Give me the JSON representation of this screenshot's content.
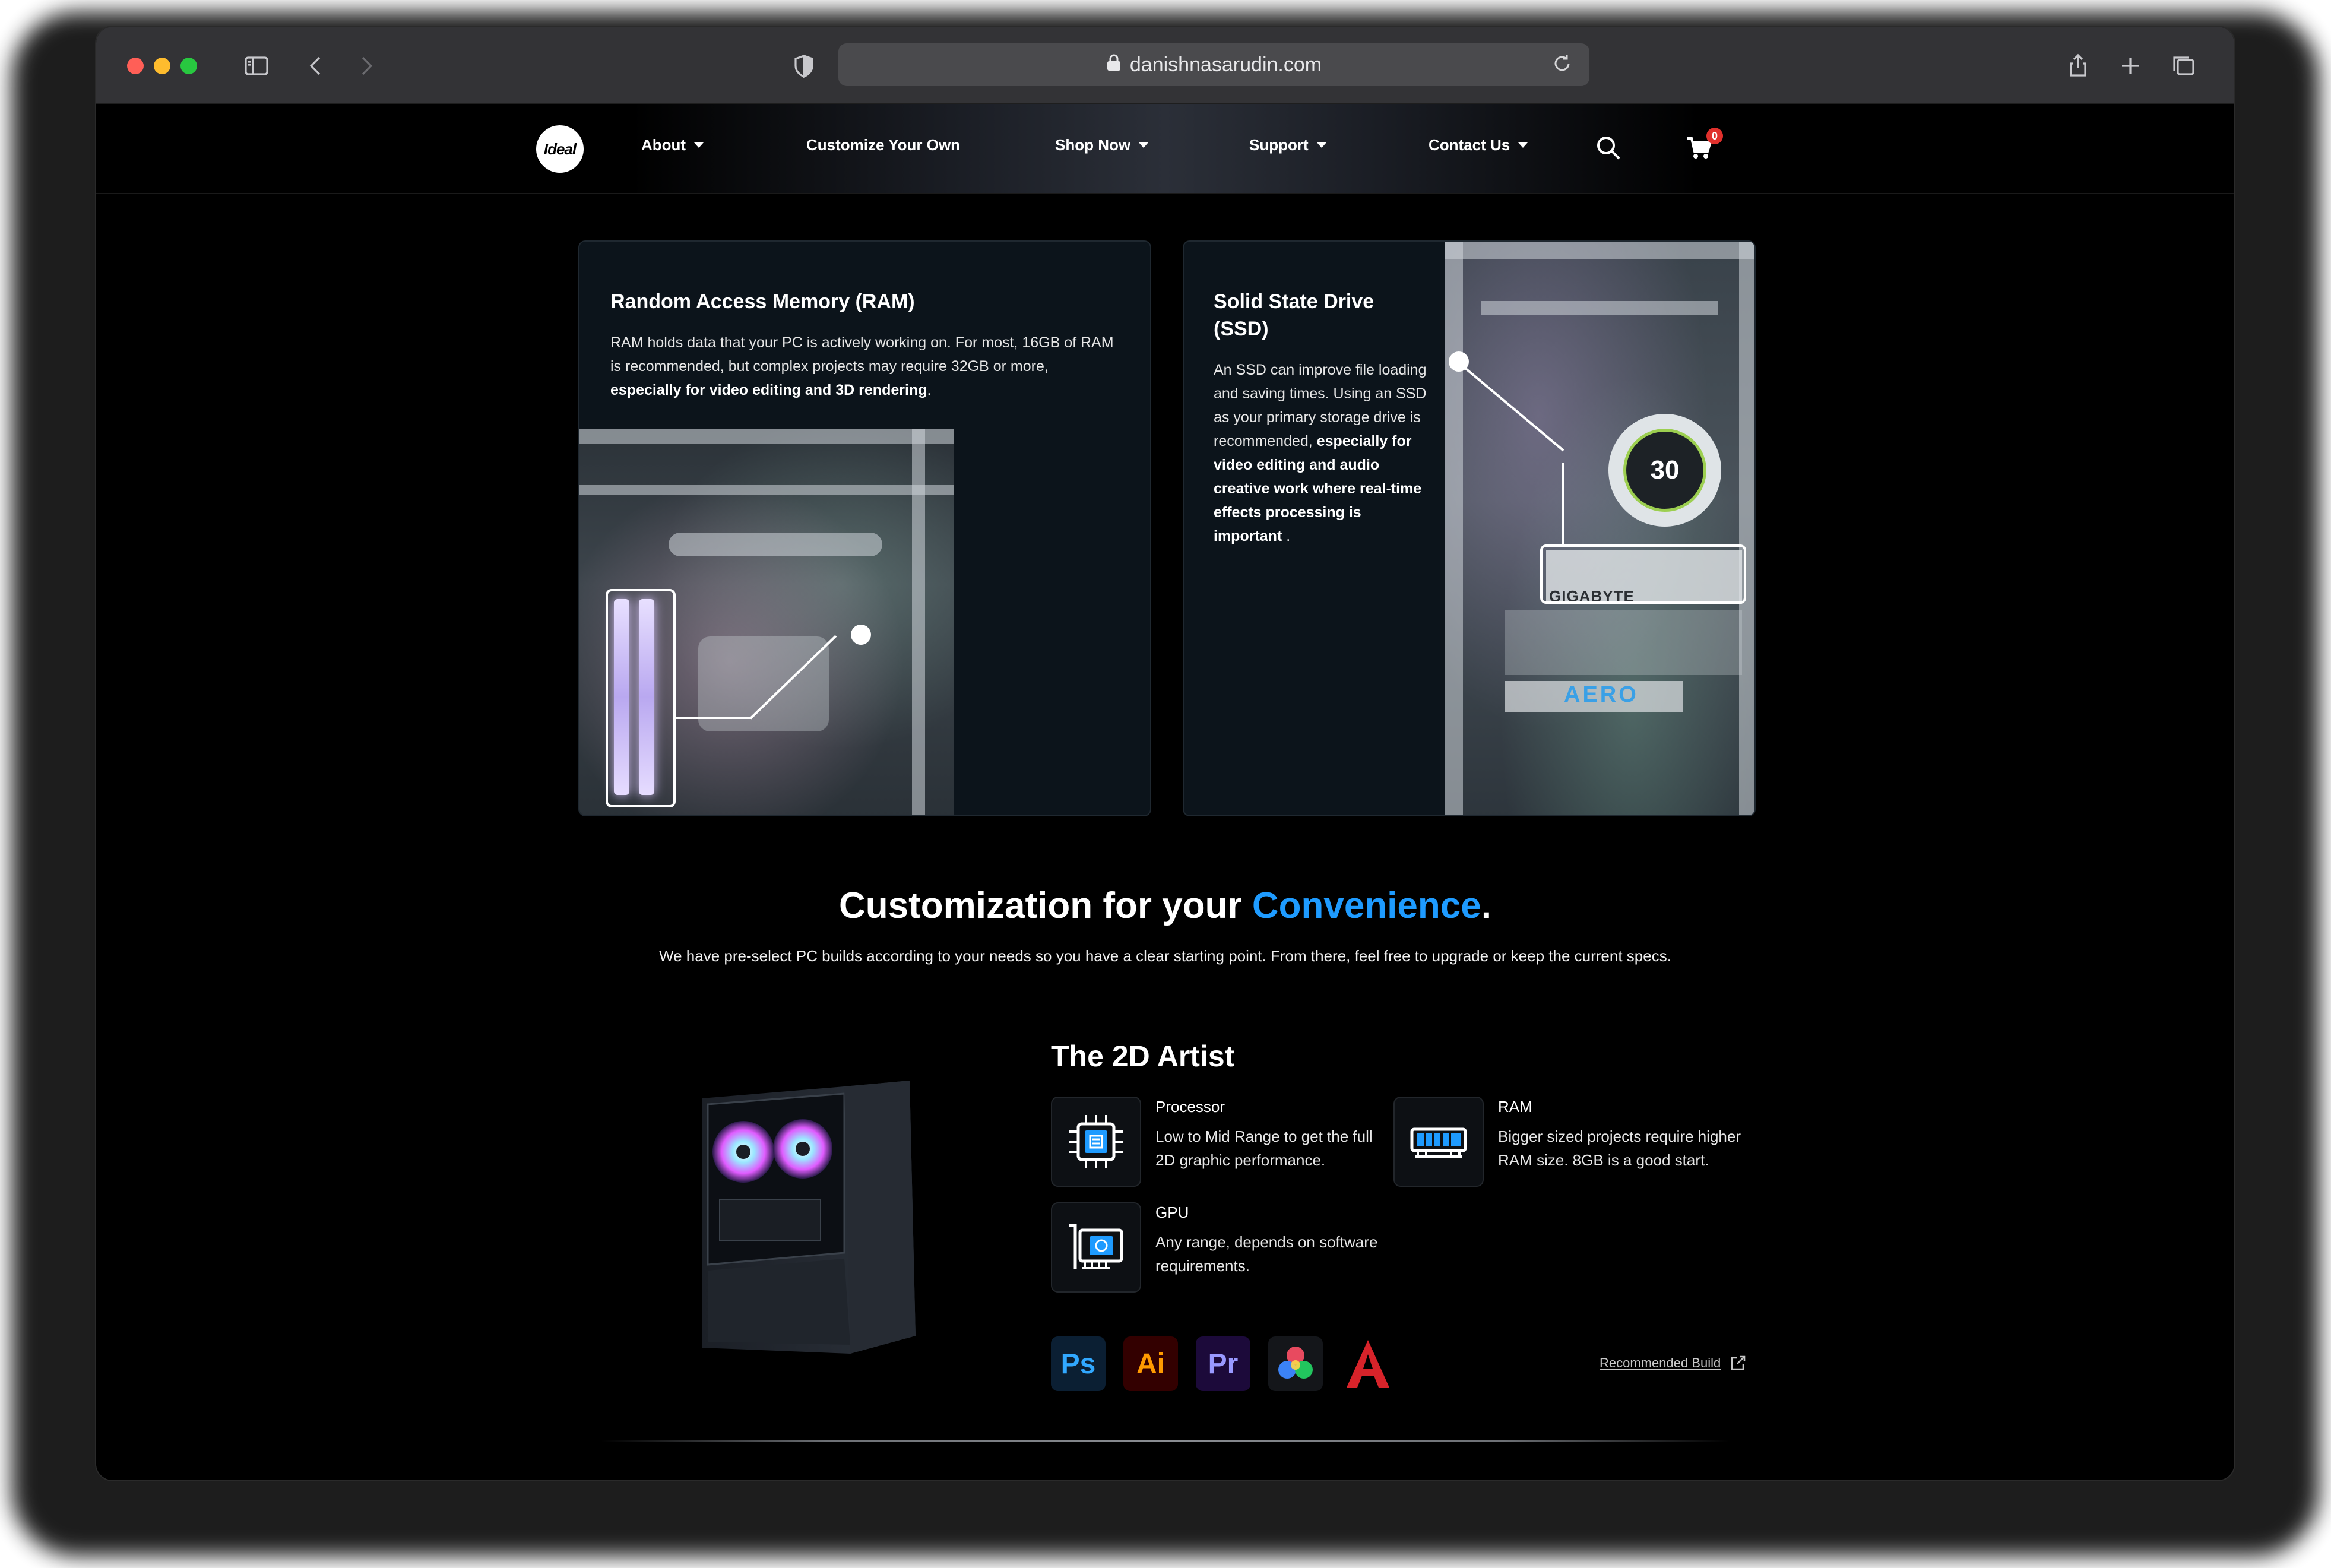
{
  "browser": {
    "url": "danishnasarudin.com"
  },
  "nav": {
    "logo_text": "Ideal",
    "items": [
      {
        "label": "About",
        "dropdown": true
      },
      {
        "label": "Customize Your Own",
        "dropdown": false
      },
      {
        "label": "Shop Now",
        "dropdown": true
      },
      {
        "label": "Support",
        "dropdown": true
      },
      {
        "label": "Contact Us",
        "dropdown": true
      }
    ],
    "cart_count": "0"
  },
  "cards": {
    "ram": {
      "title": "Random Access Memory (RAM)",
      "body_plain": "RAM holds data that your PC is actively working on. For most, 16GB of RAM is recommended, but complex projects may require 32GB or more, ",
      "body_bold": "especially for video editing and 3D rendering",
      "body_end": "."
    },
    "ssd": {
      "title": "Solid State Drive (SSD)",
      "body_plain": "An SSD can improve file loading and saving times. Using an SSD as your primary storage drive is recommended, ",
      "body_bold": "especially for video editing and audio creative work where real-time effects processing is important",
      "body_end": " .",
      "pump_reading": "30",
      "gpu_brand": "GIGABYTE",
      "gpu_series": "AERO"
    }
  },
  "section": {
    "title_main": "Customization for your ",
    "title_accent": "Convenience",
    "title_end": ".",
    "subtitle": "We have pre-select PC builds according to your needs so you have a clear starting point. From there, feel free to upgrade or keep the current specs."
  },
  "build": {
    "name": "The 2D Artist",
    "specs": [
      {
        "label": "Processor",
        "desc": "Low to Mid Range to get the full 2D graphic performance.",
        "icon": "cpu-icon"
      },
      {
        "label": "RAM",
        "desc": "Bigger sized projects require higher RAM size. 8GB is a good start.",
        "icon": "ram-icon"
      },
      {
        "label": "GPU",
        "desc": "Any range, depends on software requirements.",
        "icon": "gpu-icon"
      }
    ],
    "apps": [
      "Ps",
      "Ai",
      "Pr",
      "DaVinci Resolve",
      "Autodesk AutoCAD"
    ],
    "recommended_link": "Recommended Build"
  },
  "colors": {
    "accent": "#1e9bff",
    "background": "#000000",
    "card_bg": "#0c141b"
  }
}
